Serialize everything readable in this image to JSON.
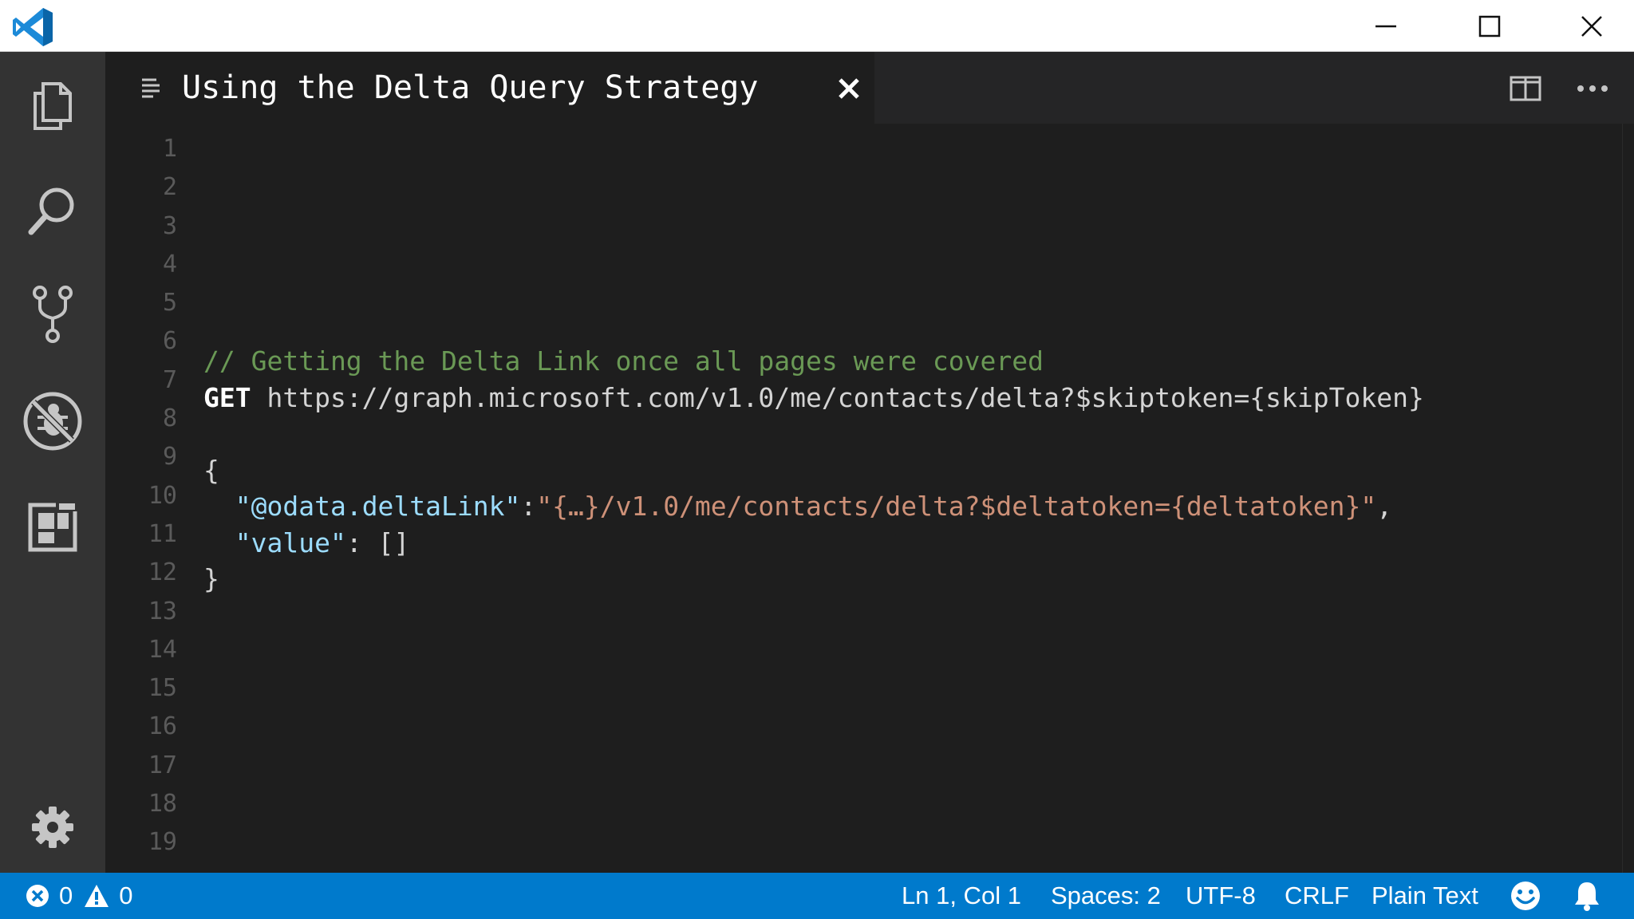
{
  "window": {
    "app_icon": "vscode-logo-icon",
    "controls": [
      "minimize-icon",
      "maximize-icon",
      "close-icon"
    ]
  },
  "activity_bar": {
    "items": [
      {
        "icon": "explorer-icon"
      },
      {
        "icon": "search-icon"
      },
      {
        "icon": "source-control-icon"
      },
      {
        "icon": "debug-icon"
      },
      {
        "icon": "extensions-icon"
      }
    ],
    "bottom": {
      "icon": "gear-icon"
    }
  },
  "tab": {
    "title": "Using the Delta Query Strategy",
    "icon": "file-lines-icon",
    "close_icon": "close-icon"
  },
  "editor_actions": [
    "split-editor-icon",
    "more-actions-icon"
  ],
  "editor": {
    "line_numbers": [
      "1",
      "2",
      "3",
      "4",
      "5",
      "6",
      "7",
      "8",
      "9",
      "10",
      "11",
      "12",
      "13",
      "14",
      "15",
      "16",
      "17",
      "18",
      "19"
    ],
    "code": {
      "comment": "// Getting the Delta Link once all pages were covered",
      "method": "GET",
      "url": " https://graph.microsoft.com/v1.0/me/contacts/delta?$skiptoken={skipToken}",
      "open_brace": "{",
      "indent": "  ",
      "delta_key": "\"@odata.deltaLink\"",
      "colon": ":",
      "delta_value": "\"{…}/v1.0/me/contacts/delta?$deltatoken={deltatoken}\"",
      "comma": ",",
      "value_key": "\"value\"",
      "value_rest": ": []",
      "close_brace": "}"
    },
    "colors": {
      "comment": "#6a9955",
      "key": "#9cdcfe",
      "string": "#ce9178",
      "text": "#d4d4d4",
      "background": "#1e1e1e"
    }
  },
  "status_bar": {
    "errors": "0",
    "warnings": "0",
    "position": "Ln 1, Col 1",
    "spaces": "Spaces: 2",
    "encoding": "UTF-8",
    "eol": "CRLF",
    "language": "Plain Text",
    "feedback_icon": "smiley-icon",
    "notifications_icon": "bell-icon",
    "color": "#007acc"
  }
}
